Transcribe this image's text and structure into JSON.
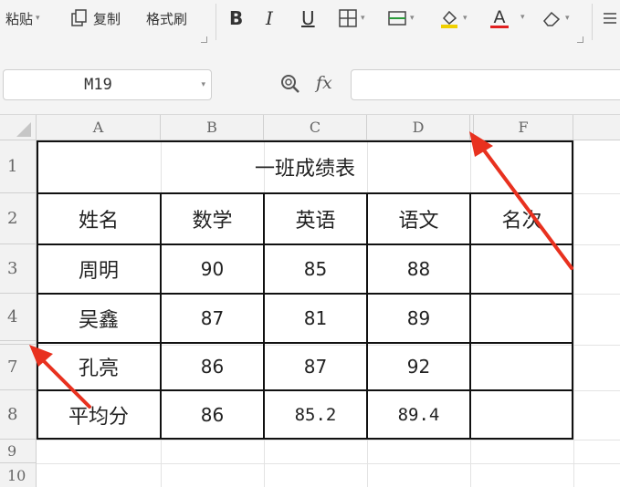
{
  "ribbon": {
    "paste": "粘贴",
    "copy": "复制",
    "format_painter": "格式刷",
    "bold": "B",
    "italic": "I",
    "underline": "U",
    "font_color_letter": "A"
  },
  "formula_bar": {
    "name_box": "M19",
    "fx": "fx",
    "formula": ""
  },
  "columns": [
    "A",
    "B",
    "C",
    "D",
    "F"
  ],
  "rows": [
    "1",
    "2",
    "3",
    "4",
    "7",
    "8",
    "9",
    "10"
  ],
  "sheet": {
    "title": "一班成绩表",
    "headers": [
      "姓名",
      "数学",
      "英语",
      "语文",
      "名次"
    ],
    "data": [
      [
        "周明",
        "90",
        "85",
        "88",
        ""
      ],
      [
        "吴鑫",
        "87",
        "81",
        "89",
        ""
      ],
      [
        "孔亮",
        "86",
        "87",
        "92",
        ""
      ],
      [
        "平均分",
        "86",
        "85.2",
        "89.4",
        ""
      ]
    ]
  },
  "colors": {
    "arrow": "#e8311f",
    "table_border": "#111111",
    "font_color_bar": "#e02020",
    "fill_color_bar": "#f0d000"
  }
}
